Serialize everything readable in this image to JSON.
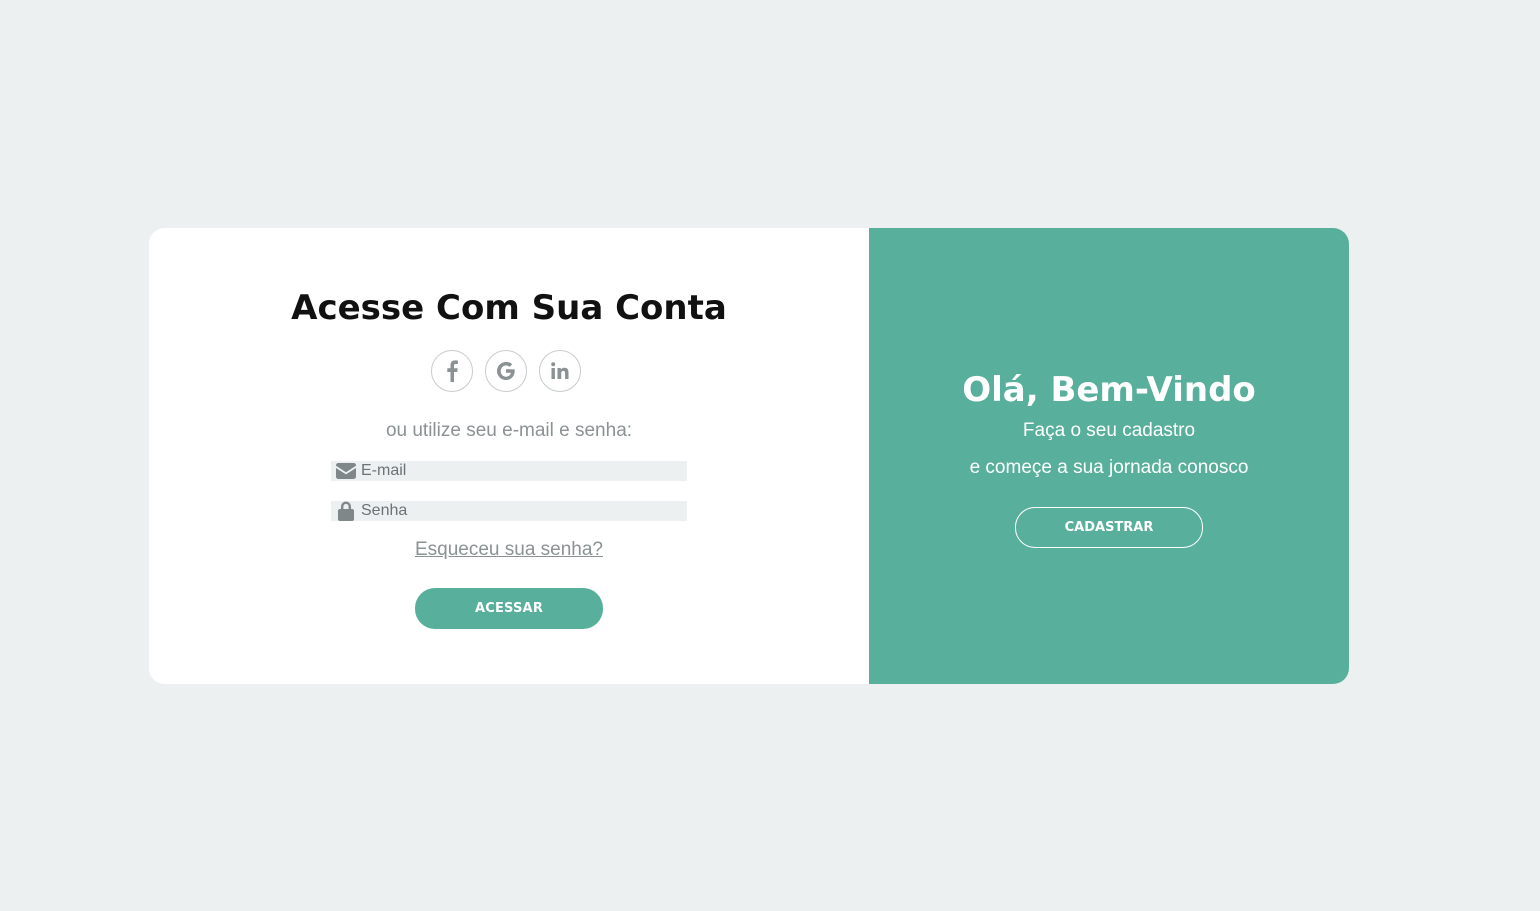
{
  "login": {
    "title": "Acesse Com Sua Conta",
    "social": [
      {
        "icon": "facebook-icon"
      },
      {
        "icon": "google-icon"
      },
      {
        "icon": "linkedin-icon"
      }
    ],
    "subtitle": "ou utilize seu e-mail e senha:",
    "email": {
      "placeholder": "E-mail",
      "value": "",
      "icon": "envelope-icon"
    },
    "password": {
      "placeholder": "Senha",
      "value": "",
      "icon": "lock-icon"
    },
    "forgot_label": "Esqueceu sua senha?",
    "submit_label": "ACESSAR"
  },
  "welcome": {
    "title": "Olá, Bem-Vindo",
    "line1": "Faça o seu cadastro",
    "line2": "e começe a sua jornada conosco",
    "register_label": "CADASTRAR"
  },
  "colors": {
    "background": "#ecf0f1",
    "accent": "#58af9b",
    "card": "#ffffff",
    "muted_text": "#8a9294",
    "icon": "#8a9294"
  }
}
